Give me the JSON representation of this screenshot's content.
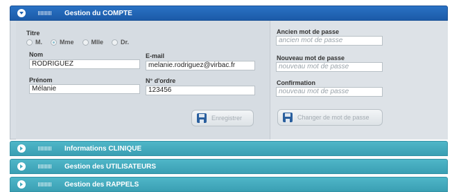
{
  "panels": {
    "account": {
      "title": "Gestion du COMPTE"
    },
    "clinic": {
      "title": "Informations CLINIQUE"
    },
    "users": {
      "title": "Gestion des UTILISATEURS"
    },
    "reminders": {
      "title": "Gestion des RAPPELS"
    }
  },
  "form": {
    "titre_label": "Titre",
    "title_options": [
      {
        "label": "M.",
        "selected": false
      },
      {
        "label": "Mme",
        "selected": true
      },
      {
        "label": "Mlle",
        "selected": false
      },
      {
        "label": "Dr.",
        "selected": false
      }
    ],
    "nom_label": "Nom",
    "nom_value": "RODRIGUEZ",
    "email_label": "E-mail",
    "email_value": "melanie.rodriguez@virbac.fr",
    "prenom_label": "Prénom",
    "prenom_value": "Mélanie",
    "ordre_label": "N° d'ordre",
    "ordre_value": "123456",
    "save_label": "Enregistrer"
  },
  "password": {
    "old_label": "Ancien mot de passe",
    "old_placeholder": "ancien mot de passe",
    "new_label": "Nouveau mot de passe",
    "new_placeholder": "nouveau mot de passe",
    "confirm_label": "Confirmation",
    "confirm_placeholder": "nouveau mot de passe",
    "change_label": "Changer de mot de passe"
  },
  "colors": {
    "header_blue": "#1f63b3",
    "header_teal": "#45abbf",
    "panel_bg": "#d9dfe5"
  }
}
